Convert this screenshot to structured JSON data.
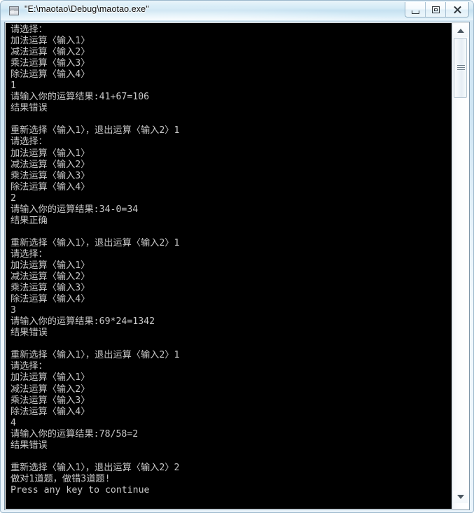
{
  "window": {
    "title": "\"E:\\maotao\\Debug\\maotao.exe\"",
    "icon": "console-app-icon",
    "buttons": {
      "minimize": "Minimize",
      "maximize": "Maximize",
      "close": "Close"
    }
  },
  "console": {
    "prompt_header": "请选择：",
    "menu": [
      "加法运算〈输入1〉",
      "减法运算〈输入2〉",
      "乘法运算〈输入3〉",
      "除法运算〈输入4〉"
    ],
    "result_prompt": "请输入你的运算结果:",
    "again_prompt": "重新选择〈输入1〉，退出运算〈输入2〉",
    "correct_text": "结果正确",
    "wrong_text": "结果错误",
    "summary": "做对1道题，做错3道题!",
    "footer": "Press any key to continue",
    "rounds": [
      {
        "choice": "1",
        "expression": "41+67=106",
        "verdict": "结果错误",
        "again_answer": "1"
      },
      {
        "choice": "2",
        "expression": "34-0=34",
        "verdict": "结果正确",
        "again_answer": "1"
      },
      {
        "choice": "3",
        "expression": "69*24=1342",
        "verdict": "结果错误",
        "again_answer": "1"
      },
      {
        "choice": "4",
        "expression": "78/58=2",
        "verdict": "结果错误",
        "again_answer": "2"
      }
    ],
    "full_text": "请选择：\n加法运算〈输入1〉\n减法运算〈输入2〉\n乘法运算〈输入3〉\n除法运算〈输入4〉\n1\n请输入你的运算结果:41+67=106\n结果错误\n\n重新选择〈输入1〉，退出运算〈输入2〉1\n请选择：\n加法运算〈输入1〉\n减法运算〈输入2〉\n乘法运算〈输入3〉\n除法运算〈输入4〉\n2\n请输入你的运算结果:34-0=34\n结果正确\n\n重新选择〈输入1〉，退出运算〈输入2〉1\n请选择：\n加法运算〈输入1〉\n减法运算〈输入2〉\n乘法运算〈输入3〉\n除法运算〈输入4〉\n3\n请输入你的运算结果:69*24=1342\n结果错误\n\n重新选择〈输入1〉，退出运算〈输入2〉1\n请选择：\n加法运算〈输入1〉\n减法运算〈输入2〉\n乘法运算〈输入3〉\n除法运算〈输入4〉\n4\n请输入你的运算结果:78/58=2\n结果错误\n\n重新选择〈输入1〉，退出运算〈输入2〉2\n做对1道题，做错3道题!\nPress any key to continue"
  },
  "scrollbar": {
    "up_arrow": "scroll-up-arrow",
    "down_arrow": "scroll-down-arrow",
    "thumb": "scroll-thumb"
  },
  "colors": {
    "console_bg": "#000000",
    "console_fg": "#c8c8c8",
    "console_highlight": "#ffffff",
    "window_frame": "#cfe5f3"
  }
}
